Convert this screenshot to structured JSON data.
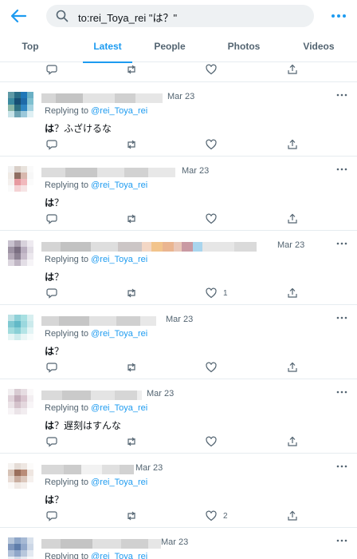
{
  "search": {
    "query": "to:rei_Toya_rei \"は？\""
  },
  "tabs": [
    {
      "label": "Top",
      "active": false
    },
    {
      "label": "Latest",
      "active": true
    },
    {
      "label": "People",
      "active": false
    },
    {
      "label": "Photos",
      "active": false
    },
    {
      "label": "Videos",
      "active": false
    }
  ],
  "tweets": [
    {
      "date": "Mar 23",
      "replying_prefix": "Replying to",
      "replying_handle": "@rei_Toya_rei",
      "text_bold": "は",
      "text_rest": "？ふざけるな",
      "likes": ""
    },
    {
      "date": "Mar 23",
      "replying_prefix": "Replying to",
      "replying_handle": "@rei_Toya_rei",
      "text_bold": "は",
      "text_rest": "？",
      "likes": ""
    },
    {
      "date": "Mar 23",
      "replying_prefix": "Replying to",
      "replying_handle": "@rei_Toya_rei",
      "text_bold": "は",
      "text_rest": "？",
      "likes": "1"
    },
    {
      "date": "Mar 23",
      "replying_prefix": "Replying to",
      "replying_handle": "@rei_Toya_rei",
      "text_bold": "は",
      "text_rest": "？",
      "likes": ""
    },
    {
      "date": "Mar 23",
      "replying_prefix": "Replying to",
      "replying_handle": "@rei_Toya_rei",
      "text_bold": "は",
      "text_rest": "？遅刻はすんな",
      "likes": ""
    },
    {
      "date": "Mar 23",
      "replying_prefix": "Replying to",
      "replying_handle": "@rei_Toya_rei",
      "text_bold": "は",
      "text_rest": "？",
      "likes": "2"
    },
    {
      "date": "Mar 23",
      "replying_prefix": "Replying to",
      "replying_handle": "@rei_Toya_rei",
      "text_bold": "",
      "text_rest": "",
      "likes": ""
    }
  ],
  "colors": {
    "accent": "#1d9bf0",
    "muted": "#536471",
    "divider": "#e6ecf0"
  },
  "icons": [
    "back-arrow-icon",
    "search-icon",
    "more-icon",
    "reply-icon",
    "retweet-icon",
    "like-icon",
    "share-icon"
  ]
}
